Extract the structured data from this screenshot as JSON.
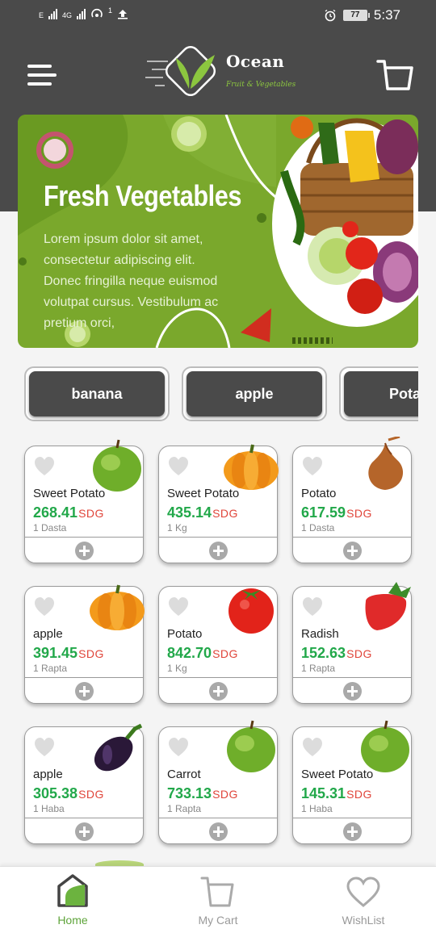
{
  "status_bar": {
    "network_left": "E",
    "network_right": "4G",
    "notification_count": "1",
    "battery": "77",
    "time": "5:37"
  },
  "header": {
    "brand_name": "Ocean",
    "brand_tagline": "Fruit & Vegetables",
    "menu_icon": "hamburger-icon",
    "cart_icon": "cart-icon"
  },
  "banner": {
    "title": "Fresh Vegetables",
    "text": "Lorem ipsum dolor sit amet, consectetur adipiscing elit. Donec fringilla neque euismod volutpat cursus. Vestibulum ac pretium orci,"
  },
  "categories": [
    "banana",
    "apple",
    "Potato"
  ],
  "currency": "SDG",
  "products": [
    {
      "name": "Sweet Potato",
      "price": "268.41",
      "unit": "1 Dasta",
      "image": "green-apple"
    },
    {
      "name": "Sweet Potato",
      "price": "435.14",
      "unit": "1 Kg",
      "image": "pumpkin"
    },
    {
      "name": "Potato",
      "price": "617.59",
      "unit": "1 Dasta",
      "image": "onion"
    },
    {
      "name": "apple",
      "price": "391.45",
      "unit": "1 Rapta",
      "image": "pumpkin"
    },
    {
      "name": "Potato",
      "price": "842.70",
      "unit": "1 Kg",
      "image": "tomato"
    },
    {
      "name": "Radish",
      "price": "152.63",
      "unit": "1 Rapta",
      "image": "strawberry"
    },
    {
      "name": "apple",
      "price": "305.38",
      "unit": "1 Haba",
      "image": "eggplant"
    },
    {
      "name": "Carrot",
      "price": "733.13",
      "unit": "1 Rapta",
      "image": "green-apple"
    },
    {
      "name": "Sweet Potato",
      "price": "145.31",
      "unit": "1 Haba",
      "image": "green-apple"
    }
  ],
  "bottom_nav": [
    {
      "label": "Home",
      "icon": "home-icon",
      "active": true
    },
    {
      "label": "My Cart",
      "icon": "cart-icon",
      "active": false
    },
    {
      "label": "WishList",
      "icon": "heart-icon",
      "active": false
    }
  ],
  "colors": {
    "header_bg": "#4a4a4a",
    "price_green": "#22a84a",
    "currency_red": "#e0453a",
    "brand_green": "#8cc63f",
    "active_nav": "#5ea43a"
  }
}
